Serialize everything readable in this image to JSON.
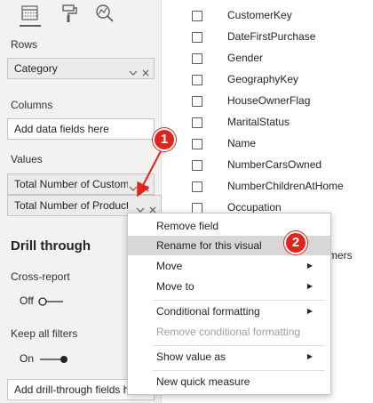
{
  "pane": {
    "rows_label": "Rows",
    "rows_field": "Category",
    "columns_label": "Columns",
    "columns_placeholder": "Add data fields here",
    "values_label": "Values",
    "values_field_1": "Total Number of Customers",
    "values_field_2": "Total Number of Products",
    "drill_title": "Drill through",
    "cross_report_label": "Cross-report",
    "cross_report_state": "Off",
    "keep_filters_label": "Keep all filters",
    "keep_filters_state": "On",
    "drill_placeholder": "Add drill-through fields here"
  },
  "field_list": [
    "CustomerKey",
    "DateFirstPurchase",
    "Gender",
    "GeographyKey",
    "HouseOwnerFlag",
    "MaritalStatus",
    "Name",
    "NumberCarsOwned",
    "NumberChildrenAtHome",
    "Occupation"
  ],
  "partial_field_text": "mers",
  "context_menu": {
    "remove_field": "Remove field",
    "rename": "Rename for this visual",
    "move": "Move",
    "move_to": "Move to",
    "conditional_formatting": "Conditional formatting",
    "remove_conditional_formatting": "Remove conditional formatting",
    "show_value_as": "Show value as",
    "new_quick_measure": "New quick measure"
  },
  "callouts": {
    "one": "1",
    "two": "2"
  },
  "colors": {
    "callout": "#e2231a",
    "highlight": "#d7d7d7",
    "pane_bg": "#f3f2f1"
  },
  "icons": {
    "tab_fields": "table-fields-icon",
    "tab_format": "paint-roller-icon",
    "tab_analytics": "magnifier-chart-icon",
    "chevron": "chevron-down-icon",
    "remove": "close-icon",
    "submenu": "triangle-right-icon"
  }
}
